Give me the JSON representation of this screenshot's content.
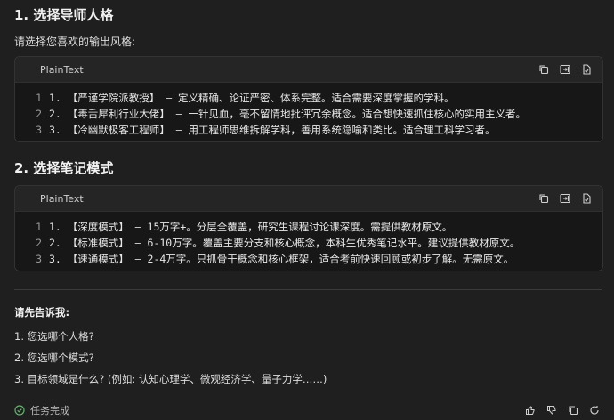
{
  "section1": {
    "title": "1. 选择导师人格",
    "intro": "请选择您喜欢的输出风格:",
    "code": {
      "lang": "PlainText",
      "lines": [
        {
          "n": "1",
          "text": "1. 【严谨学院派教授】 — 定义精确、论证严密、体系完整。适合需要深度掌握的学科。"
        },
        {
          "n": "2",
          "text": "2. 【毒舌犀利行业大佬】 — 一针见血，毫不留情地批评冗余概念。适合想快速抓住核心的实用主义者。"
        },
        {
          "n": "3",
          "text": "3. 【冷幽默极客工程师】 — 用工程师思维拆解学科，善用系统隐喻和类比。适合理工科学习者。"
        }
      ]
    }
  },
  "section2": {
    "title": "2. 选择笔记模式",
    "code": {
      "lang": "PlainText",
      "lines": [
        {
          "n": "1",
          "text": "1. 【深度模式】 — 15万字+。分层全覆盖，研究生课程讨论课深度。需提供教材原文。"
        },
        {
          "n": "2",
          "text": "2. 【标准模式】 — 6-10万字。覆盖主要分支和核心概念，本科生优秀笔记水平。建议提供教材原文。"
        },
        {
          "n": "3",
          "text": "3. 【速通模式】 — 2-4万字。只抓骨干概念和核心框架，适合考前快速回顾或初步了解。无需原文。"
        }
      ]
    }
  },
  "ask": {
    "title": "请先告诉我:",
    "items": [
      "1. 您选哪个人格?",
      "2. 您选哪个模式?",
      "3. 目标领域是什么? (例如: 认知心理学、微观经济学、量子力学……)"
    ]
  },
  "footer": {
    "status": "任务完成"
  },
  "icons": {
    "copy": "copy-icon",
    "insert": "insert-icon",
    "apply": "apply-icon",
    "thumbs_up": "thumbs-up-icon",
    "thumbs_down": "thumbs-down-icon",
    "copy_footer": "copy-icon",
    "retry": "retry-icon",
    "status": "check-circle-icon"
  },
  "colors": {
    "background": "#1f1f1f",
    "code_bg": "#171717",
    "code_header": "#252525"
  }
}
